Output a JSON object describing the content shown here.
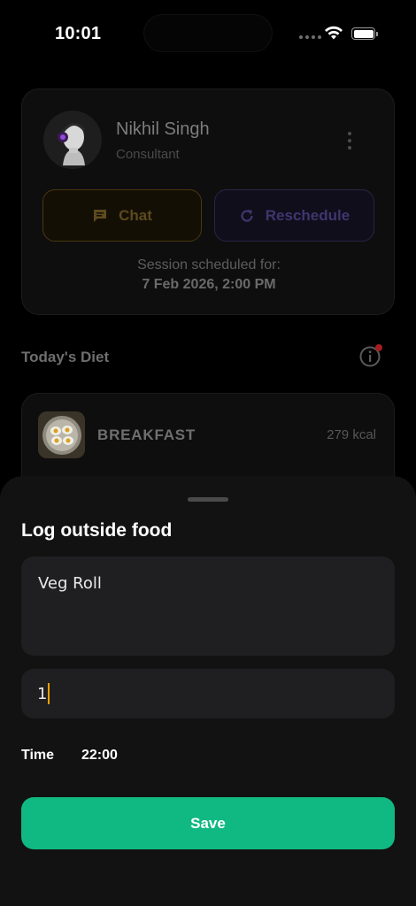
{
  "status_bar": {
    "time": "10:01"
  },
  "consultant": {
    "name": "Nikhil Singh",
    "role": "Consultant",
    "chat_label": "Chat",
    "reschedule_label": "Reschedule",
    "session_label": "Session scheduled for:",
    "session_datetime": "7 Feb 2026, 2:00 PM"
  },
  "diet": {
    "title": "Today's Diet",
    "meal": {
      "name": "BREAKFAST",
      "calories": "279 kcal"
    }
  },
  "sheet": {
    "title": "Log outside food",
    "food_value": "Veg Roll",
    "quantity_value": "1",
    "time_label": "Time",
    "time_value": "22:00",
    "save_label": "Save"
  },
  "colors": {
    "accent_green": "#10b981",
    "chat_amber": "#5d4a1d",
    "reschedule_purple": "#3f3670",
    "notification_red": "#a51d1d"
  }
}
